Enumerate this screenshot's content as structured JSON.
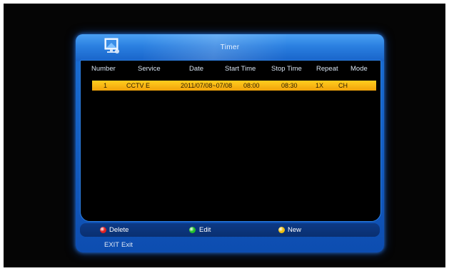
{
  "window": {
    "title": "Timer"
  },
  "table": {
    "columns": [
      "Number",
      "Service",
      "Date",
      "Start Time",
      "Stop Time",
      "Repeat",
      "Mode"
    ],
    "rows": [
      {
        "number": "1",
        "service": "CCTV E",
        "date": "2011/07/08~07/08",
        "start": "08:00",
        "stop": "08:30",
        "repeat": "1X",
        "mode": "CH"
      }
    ]
  },
  "footer": {
    "delete_label": "Delete",
    "edit_label": "Edit",
    "new_label": "New",
    "colors": {
      "delete": "#e02020",
      "edit": "#22c02a",
      "new": "#f0c010"
    }
  },
  "exit": {
    "key": "EXIT",
    "label": "Exit"
  },
  "icons": {
    "title": "monitor-icon"
  }
}
